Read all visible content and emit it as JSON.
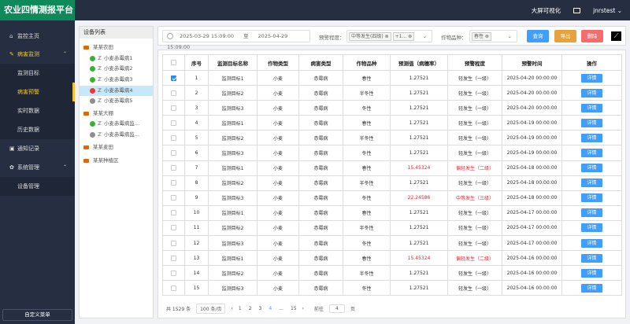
{
  "app": {
    "title": "农业四情测报平台",
    "big_screen": "大屏可视化",
    "user": "jnrstest"
  },
  "sidebar": {
    "items": [
      {
        "label": "监控主页",
        "icon": "home-icon",
        "level": 0
      },
      {
        "label": "病害监测",
        "icon": "monitor-icon",
        "level": 0,
        "expanded": true,
        "active": true
      },
      {
        "label": "监测目标",
        "level": 1
      },
      {
        "label": "病害预警",
        "level": 1,
        "active": true
      },
      {
        "label": "实时数据",
        "level": 1
      },
      {
        "label": "历史数据",
        "level": 1
      },
      {
        "label": "通知记录",
        "icon": "notification-icon",
        "level": 0
      },
      {
        "label": "系统管理",
        "icon": "gear-icon",
        "level": 0,
        "expanded": true
      },
      {
        "label": "设备管理",
        "level": 1
      }
    ],
    "custom_menu": "自定义菜单"
  },
  "tree": {
    "title": "设备列表",
    "nodes": [
      {
        "label": "某某农田",
        "type": "folder",
        "open": true
      },
      {
        "label": "小麦赤霉病1",
        "status": "green"
      },
      {
        "label": "小麦赤霉病2",
        "status": "green"
      },
      {
        "label": "小麦赤霉病3",
        "status": "green"
      },
      {
        "label": "小麦赤霉病4",
        "status": "red",
        "selected": true
      },
      {
        "label": "小麦赤霉病5",
        "status": "gray"
      },
      {
        "label": "某某大棚",
        "type": "folder",
        "open": true
      },
      {
        "label": "小麦赤霉病监...",
        "status": "green"
      },
      {
        "label": "小麦赤霉病监...",
        "status": "gray"
      },
      {
        "label": "某某麦田",
        "type": "folder"
      },
      {
        "label": "某某种植区",
        "type": "folder"
      }
    ]
  },
  "filter": {
    "start": "2025-03-29  15:09:00",
    "to": "至",
    "end": "2025-04-29  15:09:00",
    "level_label": "预警程度：",
    "level_tags": [
      "中等发生(四级)",
      "+1..."
    ],
    "variety_label": "作物品种：",
    "variety_tags": [
      "春性"
    ],
    "query": "查询",
    "export": "导出",
    "delete": "删除"
  },
  "colors": {
    "topbar": "#262f42",
    "logo": "#0e8a5a",
    "active": "#f1c232",
    "query": "#409eff",
    "export": "#e6a23c",
    "delete": "#f56c6c",
    "alert": "#f5222d"
  },
  "table": {
    "headers": [
      "序号",
      "监测目标名称",
      "作物类型",
      "病害类型",
      "作物品种",
      "预测值（病穗率）",
      "预警程度",
      "预警时间",
      "操作"
    ],
    "rows": [
      [
        "1",
        "监测目标1",
        "小麦",
        "赤霉病",
        "春性",
        "1.27521",
        "轻发生（一级）",
        "2025-04-20 00:00:00",
        "详情",
        true,
        false
      ],
      [
        "2",
        "监测目标2",
        "小麦",
        "赤霉病",
        "半冬性",
        "1.27521",
        "轻发生（一级）",
        "2025-04-20 00:00:00",
        "详情",
        false,
        false
      ],
      [
        "3",
        "监测目标3",
        "小麦",
        "赤霉病",
        "冬性",
        "1.27521",
        "轻发生（一级）",
        "2025-04-20 00:00:00",
        "详情",
        false,
        false
      ],
      [
        "4",
        "监测目标1",
        "小麦",
        "赤霉病",
        "春性",
        "1.27521",
        "轻发生（一级）",
        "2025-04-19 00:00:00",
        "详情",
        false,
        false
      ],
      [
        "5",
        "监测目标2",
        "小麦",
        "赤霉病",
        "半冬性",
        "1.27521",
        "轻发生（一级）",
        "2025-04-19 00:00:00",
        "详情",
        false,
        false
      ],
      [
        "6",
        "监测目标3",
        "小麦",
        "赤霉病",
        "冬性",
        "1.27521",
        "轻发生（一级）",
        "2025-04-19 00:00:00",
        "详情",
        false,
        false
      ],
      [
        "7",
        "监测目标1",
        "小麦",
        "赤霉病",
        "春性",
        "15.45324",
        "偏轻发生（二级）",
        "2025-04-18 00:00:00",
        "详情",
        false,
        true
      ],
      [
        "8",
        "监测目标2",
        "小麦",
        "赤霉病",
        "半冬性",
        "1.27521",
        "轻发生（一级）",
        "2025-04-18 00:00:00",
        "详情",
        false,
        false
      ],
      [
        "9",
        "监测目标3",
        "小麦",
        "赤霉病",
        "冬性",
        "22.24586",
        "中等发生（三级）",
        "2025-04-18 00:00:00",
        "详情",
        false,
        true
      ],
      [
        "10",
        "监测目标1",
        "小麦",
        "赤霉病",
        "春性",
        "1.27521",
        "轻发生（一级）",
        "2025-04-17 00:00:00",
        "详情",
        false,
        false
      ],
      [
        "11",
        "监测目标2",
        "小麦",
        "赤霉病",
        "半冬性",
        "1.27521",
        "轻发生（一级）",
        "2025-04-17 00:00:00",
        "详情",
        false,
        false
      ],
      [
        "12",
        "监测目标3",
        "小麦",
        "赤霉病",
        "冬性",
        "1.27521",
        "轻发生（一级）",
        "2025-04-17 00:00:00",
        "详情",
        false,
        false
      ],
      [
        "13",
        "监测目标1",
        "小麦",
        "赤霉病",
        "春性",
        "15.45324",
        "偏轻发生（二级）",
        "2025-04-16 00:00:00",
        "详情",
        false,
        true
      ],
      [
        "14",
        "监测目标2",
        "小麦",
        "赤霉病",
        "半冬性",
        "1.27521",
        "轻发生（一级）",
        "2025-04-16 00:00:00",
        "详情",
        false,
        false
      ],
      [
        "15",
        "监测目标3",
        "小麦",
        "赤霉病",
        "冬性",
        "1.27521",
        "轻发生（一级）",
        "2025-04-16 00:00:00",
        "详情",
        false,
        false
      ]
    ]
  },
  "pagination": {
    "total": "共 1529 条",
    "page_size": "100 条/页",
    "pages": [
      "1",
      "2",
      "3",
      "4",
      "...",
      "15"
    ],
    "current": "4",
    "goto_label": "前往",
    "goto_value": "4",
    "goto_suffix": "页"
  }
}
